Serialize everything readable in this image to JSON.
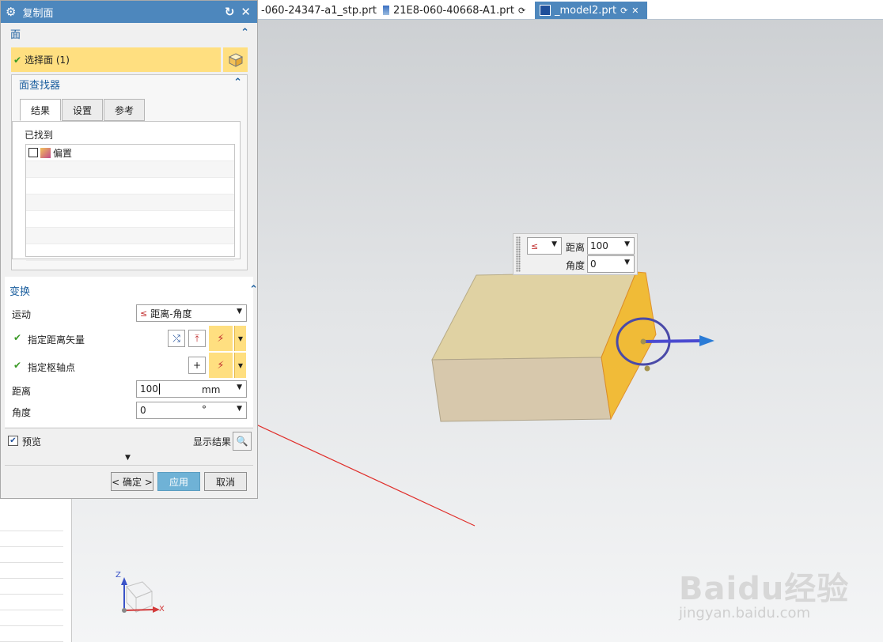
{
  "tabs": {
    "items": [
      {
        "label": "-060-24347-a1_stp.prt"
      },
      {
        "label": "21E8-060-40668-A1.prt"
      },
      {
        "label": "_model2.prt"
      }
    ]
  },
  "dialog": {
    "title": "复制面",
    "face_section": {
      "title": "面",
      "select_face_label": "选择面 (1)"
    },
    "finder": {
      "title": "面查找器",
      "tabs": [
        "结果",
        "设置",
        "参考"
      ],
      "found_label": "已找到",
      "found_items": [
        "偏置"
      ]
    },
    "transform": {
      "title": "变换",
      "motion_label": "运动",
      "motion_value": "距离-角度",
      "distance_vector_label": "指定距离矢量",
      "pivot_label": "指定枢轴点",
      "distance_label": "距离",
      "distance_value": "100",
      "distance_unit": "mm",
      "angle_label": "角度",
      "angle_value": "0",
      "angle_unit": "°"
    },
    "preview_label": "预览",
    "show_result_label": "显示结果",
    "ok_label": "< 确定 >",
    "apply_label": "应用",
    "cancel_label": "取消"
  },
  "handle_panel": {
    "distance_label": "距离",
    "distance_value": "100",
    "angle_label": "角度",
    "angle_value": "0"
  },
  "triad": {
    "z_label": "Z",
    "x_label": "X"
  },
  "watermark": {
    "logo": "Baidu经验",
    "url": "jingyan.baidu.com"
  },
  "colors": {
    "title_bar": "#4d87bd",
    "highlight": "#ffdf80",
    "accent_text": "#1a5e9e",
    "face_orange": "#f2b829"
  }
}
